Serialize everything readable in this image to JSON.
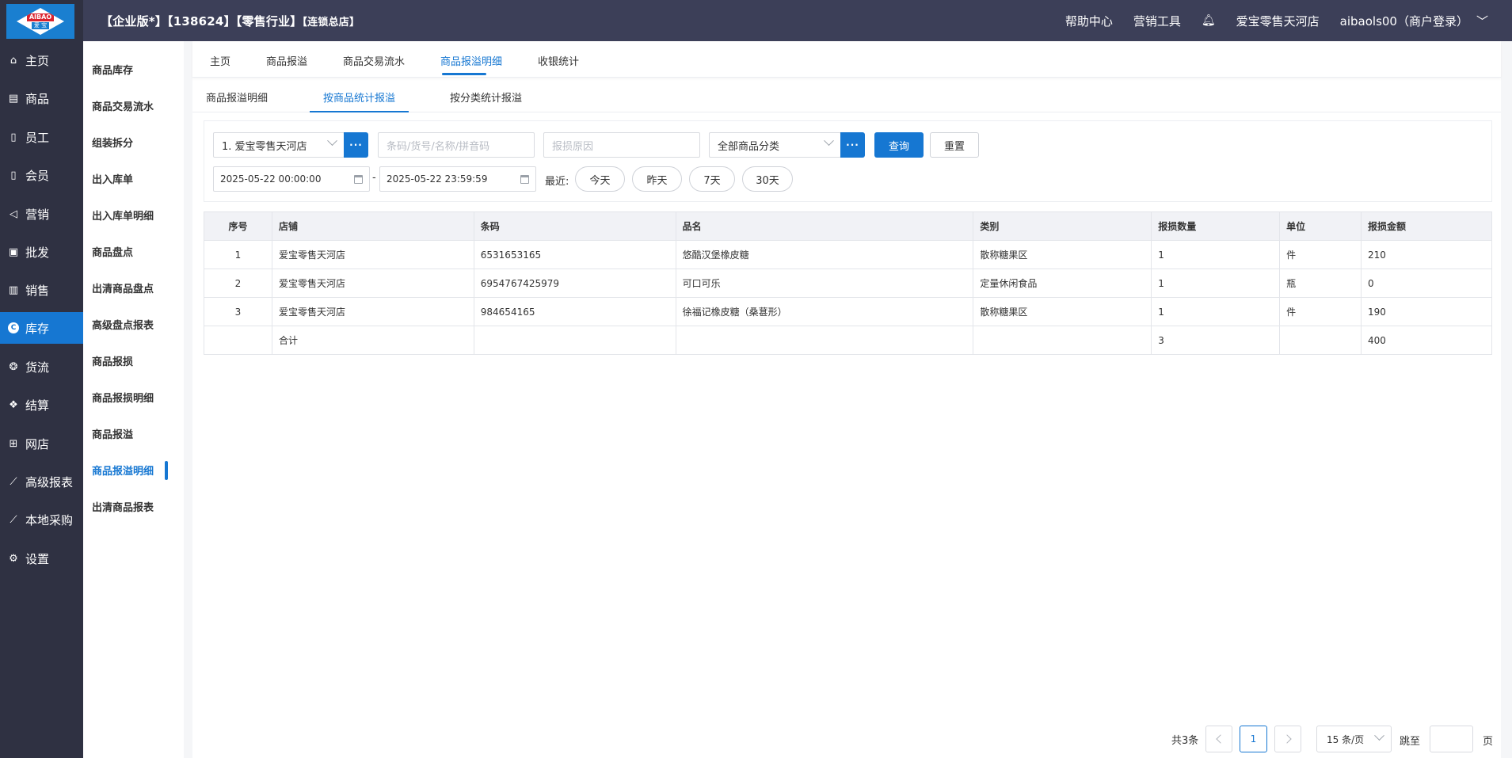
{
  "header": {
    "edition": "【企业版*】",
    "account_no": "【138624】",
    "industry": "【零售行业】",
    "store_type": "【连锁总店】",
    "help": "帮助中心",
    "marketing": "营销工具",
    "store_name": "爱宝零售天河店",
    "user": "aibaols00（商户登录）"
  },
  "logo": {
    "top": "AIBAO",
    "bottom": "爱 宝"
  },
  "leftnav": [
    {
      "label": "主页",
      "icon": "home-icon"
    },
    {
      "label": "商品",
      "icon": "box-icon"
    },
    {
      "label": "员工",
      "icon": "employee-icon"
    },
    {
      "label": "会员",
      "icon": "member-icon"
    },
    {
      "label": "营销",
      "icon": "megaphone-icon"
    },
    {
      "label": "批发",
      "icon": "wholesale-icon"
    },
    {
      "label": "销售",
      "icon": "chart-bar-icon"
    },
    {
      "label": "库存",
      "icon": "inventory-icon"
    },
    {
      "label": "货流",
      "icon": "logistics-icon"
    },
    {
      "label": "结算",
      "icon": "settlement-icon"
    },
    {
      "label": "网店",
      "icon": "gift-icon"
    },
    {
      "label": "高级报表",
      "icon": "line-chart-icon"
    },
    {
      "label": "本地采购",
      "icon": "line-chart-icon"
    },
    {
      "label": "设置",
      "icon": "gear-icon"
    }
  ],
  "submenu": [
    "商品库存",
    "商品交易流水",
    "组装拆分",
    "出入库单",
    "出入库单明细",
    "商品盘点",
    "出清商品盘点",
    "高级盘点报表",
    "商品报损",
    "商品报损明细",
    "商品报溢",
    "商品报溢明细",
    "出清商品报表"
  ],
  "tabs": [
    "主页",
    "商品报溢",
    "商品交易流水",
    "商品报溢明细",
    "收银统计"
  ],
  "subtabs": [
    "商品报溢明细",
    "按商品统计报溢",
    "按分类统计报溢"
  ],
  "filter": {
    "store": "1. 爱宝零售天河店",
    "dots": "···",
    "search_placeholder": "条码/货号/名称/拼音码",
    "reason_placeholder": "报损原因",
    "category": "全部商品分类",
    "query": "查询",
    "reset": "重置",
    "date_from": "2025-05-22 00:00:00",
    "date_sep": "-",
    "date_to": "2025-05-22 23:59:59",
    "recent_label": "最近:",
    "quick": [
      "今天",
      "昨天",
      "7天",
      "30天"
    ]
  },
  "table": {
    "headers": [
      "序号",
      "店铺",
      "条码",
      "品名",
      "类别",
      "报损数量",
      "单位",
      "报损金额"
    ],
    "rows": [
      [
        "1",
        "爱宝零售天河店",
        "6531653165",
        "悠酷汉堡橡皮糖",
        "散称糖果区",
        "1",
        "件",
        "210"
      ],
      [
        "2",
        "爱宝零售天河店",
        "6954767425979",
        "可口可乐",
        "定量休闲食品",
        "1",
        "瓶",
        "0"
      ],
      [
        "3",
        "爱宝零售天河店",
        "984654165",
        "徐福记橡皮糖（桑葚形）",
        "散称糖果区",
        "1",
        "件",
        "190"
      ]
    ],
    "total": [
      "",
      "合计",
      "",
      "",
      "",
      "3",
      "",
      "400"
    ]
  },
  "pager": {
    "total": "共3条",
    "page": "1",
    "per_page": "15 条/页",
    "jump_label": "跳至",
    "page_suffix": "页"
  },
  "colors": {
    "accent": "#1677d2",
    "nav_bg": "#2f3142",
    "header_bg": "#3c3f58"
  }
}
